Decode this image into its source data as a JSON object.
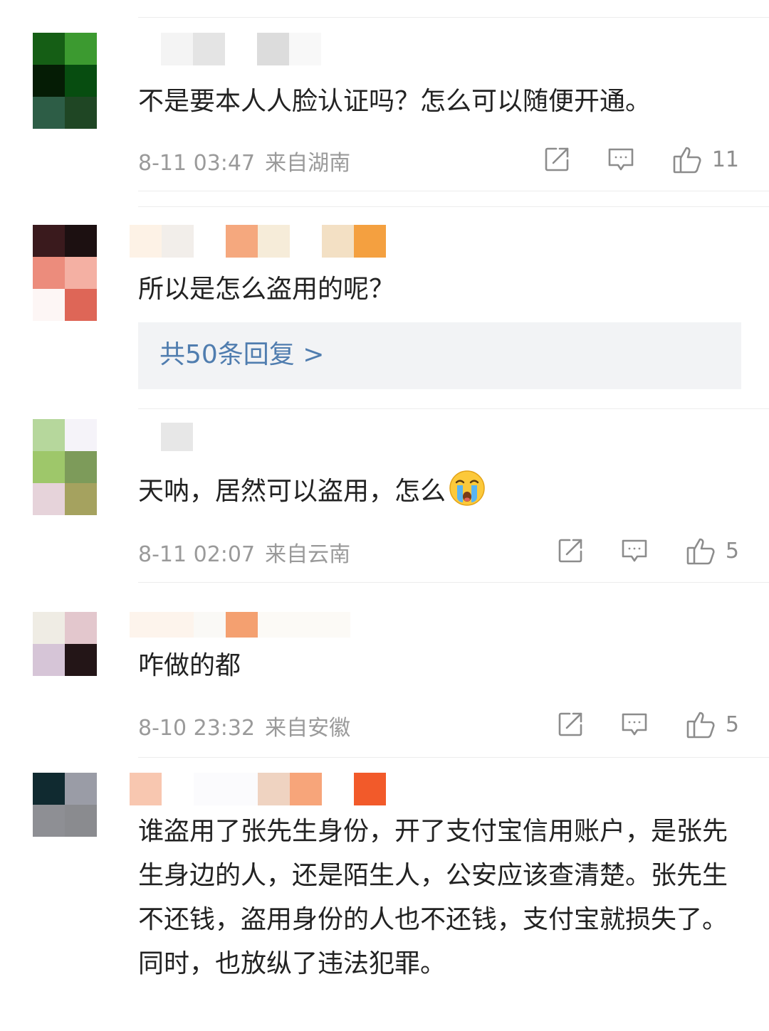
{
  "comments": [
    {
      "text": "不是要本人人脸认证吗？怎么可以随便开通。",
      "date": "8-11 03:47",
      "location": "来自湖南",
      "likes": "11",
      "avatar_colors": [
        "#155e15",
        "#3c9a30",
        "#051c05",
        "#074d10",
        "#2d5d46",
        "#1f4624"
      ],
      "name_blur_colors": [
        "#f4f4f4",
        "#e4e4e4",
        "#ffffff",
        "#dcdcdc",
        "#f8f8f8"
      ]
    },
    {
      "text": "所以是怎么盗用的呢？",
      "replies_label": "共50条回复 >",
      "avatar_colors": [
        "#3a1a1d",
        "#1c1011",
        "#ec8c7c",
        "#f4b0a3",
        "#fdf6f5",
        "#de6657"
      ],
      "name_blur_colors": [
        "#fdf2e6",
        "#f2eeea",
        "#ffffff",
        "#f5a87e",
        "#f6ecd9",
        "#ffffff",
        "#f3e0c4",
        "#f4a040"
      ]
    },
    {
      "text": "天呐，居然可以盗用，怎么",
      "emoji": "crying-face-emoji",
      "date": "8-11 02:07",
      "location": "来自云南",
      "likes": "5",
      "avatar_colors": [
        "#b6d79c",
        "#f5f3f9",
        "#9ec76a",
        "#7d9b5a",
        "#e6d3da",
        "#a5a25f"
      ],
      "name_blur_colors": [
        "#e7e7e7"
      ]
    },
    {
      "text": "咋做的都",
      "date": "8-10 23:32",
      "location": "来自安徽",
      "likes": "5",
      "avatar_colors": [
        "#efece4",
        "#e3c7cd",
        "#d6c5d7",
        "#231517"
      ],
      "name_blur_colors": [
        "#fdf4ec",
        "#faf9f6",
        "#f4a070",
        "#fcfaf6"
      ]
    },
    {
      "text": "谁盗用了张先生身份，开了支付宝信用账户，是张先生身边的人，还是陌生人，公安应该查清楚。张先生不还钱，盗用身份的人也不还钱，支付宝就损失了。同时，也放纵了违法犯罪。",
      "avatar_colors": [
        "#102a30",
        "#9a9ca6",
        "#8e8f94",
        "#8a8b8f"
      ],
      "name_blur_colors": [
        "#f8c7b0",
        "#ffffff",
        "#fbfbfd",
        "#ffffff",
        "#efd3c1",
        "#f7a57a",
        "#ffffff",
        "#f25a2a"
      ]
    }
  ],
  "icons": {
    "forward": "share-icon",
    "comment": "comment-icon",
    "like": "thumbs-up-icon"
  },
  "colors": {
    "link": "#507daf",
    "meta": "#9a9a9a",
    "text": "#222222"
  }
}
